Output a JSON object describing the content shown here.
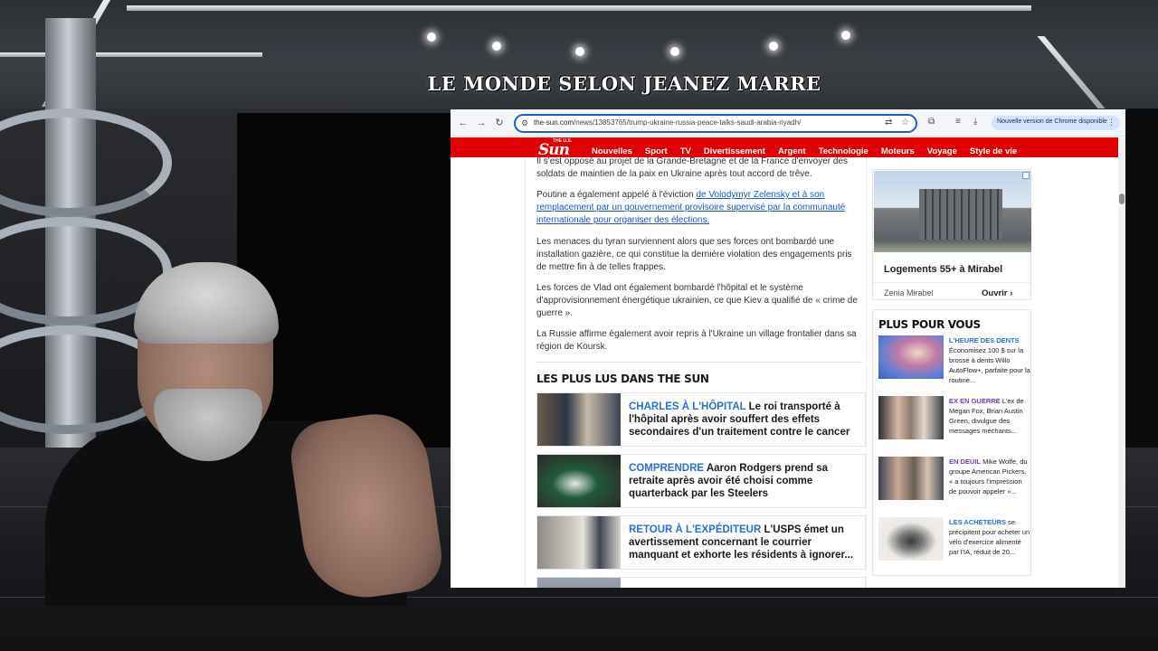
{
  "studio": {
    "show_title": "LE MONDE SELON JEANEZ MARRE"
  },
  "browser": {
    "url_host": "the-sun.com",
    "url_path": "/news/13853765/trump-ukraine-russia-peace-talks-saudi-arabia-riyadh/",
    "update_pill": "Nouvelle version de Chrome disponible",
    "icons": [
      "back-icon",
      "forward-icon",
      "reload-icon",
      "site-info-icon",
      "translate-icon",
      "bookmark-star-icon",
      "extensions-icon",
      "reading-list-icon",
      "downloads-icon",
      "menu-icon"
    ]
  },
  "site": {
    "logo_small": "THE U.S.",
    "logo": "Sun",
    "nav": [
      "Nouvelles",
      "Sport",
      "TV",
      "Divertissement",
      "Argent",
      "Technologie",
      "Moteurs",
      "Voyage",
      "Style de vie"
    ],
    "brand_color": "#e00000"
  },
  "article": {
    "p1": "Il s'est opposé au projet de la Grande-Bretagne et de la France d'envoyer des soldats de maintien de la paix en Ukraine après tout accord de trêve.",
    "p2_start": "Poutine a également appelé à l'éviction ",
    "p2_link": "de Volodymyr Zelensky et à son remplacement par un gouvernement provisoire supervisé par la communauté internationale pour organiser des élections.",
    "p3": "Les menaces du tyran surviennent alors que ses forces ont bombardé une installation gazière, ce qui constitue la dernière violation des engagements pris de mettre fin à de telles frappes.",
    "p4": "Les forces de Vlad ont également bombardé l'hôpital et le système d'approvisionnement énergétique ukrainien, ce que Kiev a qualifié de « crime de guerre ».",
    "p5": "La Russie affirme également avoir repris à l'Ukraine un village frontalier dans sa région de Koursk."
  },
  "most_read": {
    "title": "LES PLUS LUS DANS THE SUN",
    "items": [
      {
        "kicker": "CHARLES À L'HÔPITAL",
        "text": " Le roi transporté à l'hôpital après avoir souffert des effets secondaires d'un traitement contre le cancer"
      },
      {
        "kicker": "COMPRENDRE",
        "text": " Aaron Rodgers prend sa retraite après avoir été choisi comme quarterback par les Steelers"
      },
      {
        "kicker": "RETOUR À L'EXPÉDITEUR",
        "text": " L'USPS émet un avertissement concernant le courrier manquant et exhorte les résidents à ignorer..."
      }
    ]
  },
  "ad": {
    "title": "Logements 55+ à Mirabel",
    "advertiser": "Zenia Mirabel",
    "cta": "Ouvrir"
  },
  "plus_pour_vous": {
    "title": "PLUS POUR VOUS",
    "items": [
      {
        "kicker": "L'HEURE DES DENTS",
        "text": " Économisez 100 $ sur la brosse à dents Willo AutoFlow+, parfaite pour la routine..."
      },
      {
        "kicker": "EX EN GUERRE",
        "text": " L'ex de Megan Fox, Brian Austin Green, divulgue des messages méchants..."
      },
      {
        "kicker": "EN DEUIL",
        "text": " Mike Wolfe, du groupe American Pickers, « a toujours l'impression de pouvoir appeler »..."
      },
      {
        "kicker": "LES ACHETEURS",
        "text": " se précipitent pour acheter un vélo d'exercice alimenté par l'IA, réduit de 20..."
      }
    ]
  }
}
